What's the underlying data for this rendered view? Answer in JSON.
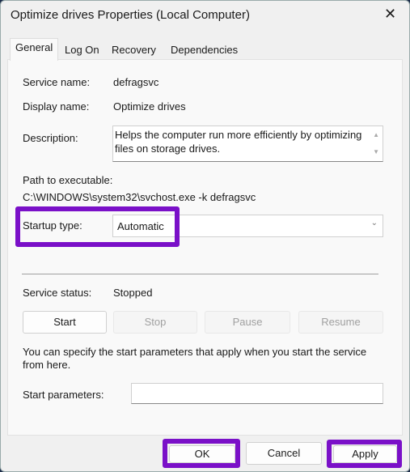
{
  "window": {
    "title": "Optimize drives Properties (Local Computer)",
    "close_icon": "close-icon"
  },
  "tabs": [
    {
      "label": "General"
    },
    {
      "label": "Log On"
    },
    {
      "label": "Recovery"
    },
    {
      "label": "Dependencies"
    }
  ],
  "general": {
    "service_name_label": "Service name:",
    "service_name": "defragsvc",
    "display_name_label": "Display name:",
    "display_name": "Optimize drives",
    "description_label": "Description:",
    "description": "Helps the computer run more efficiently by optimizing files on storage drives.",
    "path_label": "Path to executable:",
    "path": "C:\\WINDOWS\\system32\\svchost.exe -k defragsvc",
    "startup_type_label": "Startup type:",
    "startup_type": "Automatic",
    "service_status_label": "Service status:",
    "service_status": "Stopped",
    "buttons": {
      "start": "Start",
      "stop": "Stop",
      "pause": "Pause",
      "resume": "Resume"
    },
    "hint": "You can specify the start parameters that apply when you start the service from here.",
    "start_params_label": "Start parameters:",
    "start_params_value": ""
  },
  "footer": {
    "ok": "OK",
    "cancel": "Cancel",
    "apply": "Apply"
  },
  "colors": {
    "highlight": "#7a10c8"
  }
}
